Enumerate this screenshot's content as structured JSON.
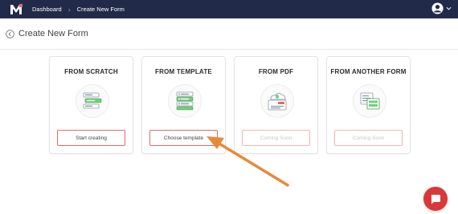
{
  "header": {
    "logo_text": "M",
    "breadcrumbs": [
      "Dashboard",
      "Create New Form"
    ],
    "user_icon": "user-avatar-icon",
    "menu_icon": "chevron-down-icon"
  },
  "page": {
    "title": "Create New Form",
    "back_icon": "back-circle-icon"
  },
  "cards": [
    {
      "title": "FROM SCRATCH",
      "button": "Start creating",
      "enabled": true,
      "icon": "form-fields-icon"
    },
    {
      "title": "FROM TEMPLATE",
      "button": "Choose template",
      "enabled": true,
      "icon": "template-list-icon"
    },
    {
      "title": "FROM PDF",
      "button": "Coming Soon",
      "enabled": false,
      "icon": "pdf-upload-icon"
    },
    {
      "title": "FROM ANOTHER FORM",
      "button": "Coming Soon",
      "enabled": false,
      "icon": "copy-form-icon"
    }
  ],
  "annotation": {
    "arrow_color": "#e8893a"
  },
  "colors": {
    "topbar": "#222a4a",
    "accent": "#e26a6a",
    "chat": "#d8383a"
  },
  "chat_icon": "chat-icon"
}
